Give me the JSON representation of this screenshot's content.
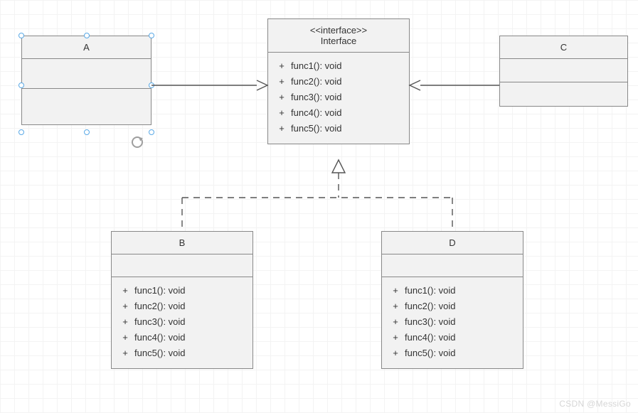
{
  "interface": {
    "stereotype": "<<interface>>",
    "name": "Interface",
    "methods": [
      {
        "vis": "+",
        "sig": "func1(): void"
      },
      {
        "vis": "+",
        "sig": "func2(): void"
      },
      {
        "vis": "+",
        "sig": "func3(): void"
      },
      {
        "vis": "+",
        "sig": "func4(): void"
      },
      {
        "vis": "+",
        "sig": "func5(): void"
      }
    ]
  },
  "classA": {
    "name": "A"
  },
  "classC": {
    "name": "C"
  },
  "classB": {
    "name": "B",
    "methods": [
      {
        "vis": "+",
        "sig": "func1(): void"
      },
      {
        "vis": "+",
        "sig": "func2(): void"
      },
      {
        "vis": "+",
        "sig": "func3(): void"
      },
      {
        "vis": "+",
        "sig": "func4(): void"
      },
      {
        "vis": "+",
        "sig": "func5(): void"
      }
    ]
  },
  "classD": {
    "name": "D",
    "methods": [
      {
        "vis": "+",
        "sig": "func1(): void"
      },
      {
        "vis": "+",
        "sig": "func2(): void"
      },
      {
        "vis": "+",
        "sig": "func3(): void"
      },
      {
        "vis": "+",
        "sig": "func4(): void"
      },
      {
        "vis": "+",
        "sig": "func5(): void"
      }
    ]
  },
  "watermark": "CSDN @MessiGo",
  "chart_data": {
    "type": "uml-class-diagram",
    "nodes": [
      {
        "id": "Interface",
        "kind": "interface",
        "stereotype": "<<interface>>",
        "selected": false,
        "operations": [
          "+ func1(): void",
          "+ func2(): void",
          "+ func3(): void",
          "+ func4(): void",
          "+ func5(): void"
        ]
      },
      {
        "id": "A",
        "kind": "class",
        "selected": true,
        "operations": []
      },
      {
        "id": "C",
        "kind": "class",
        "selected": false,
        "operations": []
      },
      {
        "id": "B",
        "kind": "class",
        "selected": false,
        "operations": [
          "+ func1(): void",
          "+ func2(): void",
          "+ func3(): void",
          "+ func4(): void",
          "+ func5(): void"
        ]
      },
      {
        "id": "D",
        "kind": "class",
        "selected": false,
        "operations": [
          "+ func1(): void",
          "+ func2(): void",
          "+ func3(): void",
          "+ func4(): void",
          "+ func5(): void"
        ]
      }
    ],
    "edges": [
      {
        "from": "A",
        "to": "Interface",
        "type": "dependency-solid",
        "arrow": "open"
      },
      {
        "from": "C",
        "to": "Interface",
        "type": "dependency-solid",
        "arrow": "open"
      },
      {
        "from": "B",
        "to": "Interface",
        "type": "realization",
        "style": "dashed",
        "arrow": "hollow-triangle"
      },
      {
        "from": "D",
        "to": "Interface",
        "type": "realization",
        "style": "dashed",
        "arrow": "hollow-triangle"
      }
    ]
  }
}
